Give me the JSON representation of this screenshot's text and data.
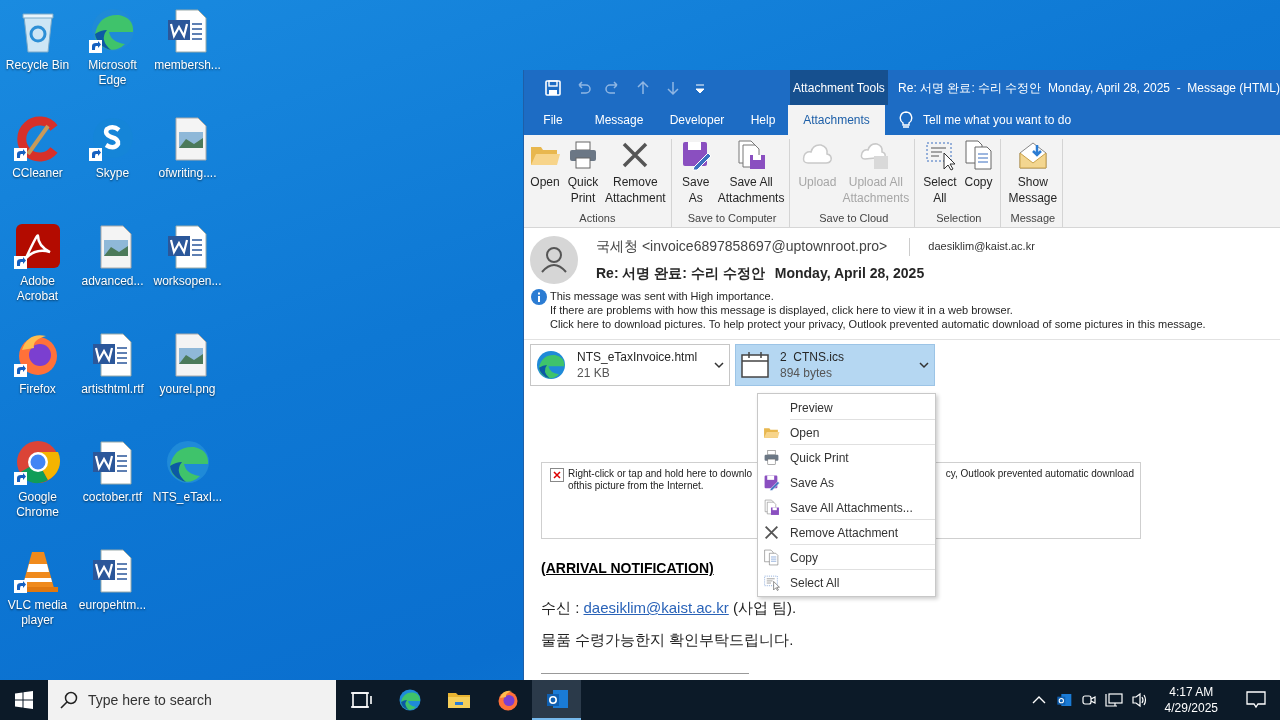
{
  "desktop": {
    "icons": [
      {
        "label": "Recycle Bin",
        "kind": "recycle",
        "shortcut": false
      },
      {
        "label": "CCleaner",
        "kind": "ccleaner",
        "shortcut": true
      },
      {
        "label": "Adobe Acrobat",
        "kind": "acrobat",
        "shortcut": true
      },
      {
        "label": "Firefox",
        "kind": "firefox",
        "shortcut": true
      },
      {
        "label": "Google Chrome",
        "kind": "chrome",
        "shortcut": true
      },
      {
        "label": "VLC media player",
        "kind": "vlc",
        "shortcut": true
      },
      {
        "label": "Microsoft Edge",
        "kind": "edge",
        "shortcut": true
      },
      {
        "label": "Skype",
        "kind": "skype",
        "shortcut": true
      },
      {
        "label": "advanced...",
        "kind": "image",
        "shortcut": false
      },
      {
        "label": "artisthtml.rtf",
        "kind": "word",
        "shortcut": false
      },
      {
        "label": "coctober.rtf",
        "kind": "word",
        "shortcut": false
      },
      {
        "label": "europehtm...",
        "kind": "word",
        "shortcut": false
      },
      {
        "label": "membersh...",
        "kind": "word",
        "shortcut": false
      },
      {
        "label": "ofwriting....",
        "kind": "image",
        "shortcut": false
      },
      {
        "label": "worksopen...",
        "kind": "word",
        "shortcut": false
      },
      {
        "label": "yourel.png",
        "kind": "image",
        "shortcut": false
      },
      {
        "label": "NTS_eTaxI...",
        "kind": "edge",
        "shortcut": false
      }
    ]
  },
  "window": {
    "context_tab": "Attachment Tools",
    "title": "Re: 서명 완료: 수리 수정안  Monday, April 28, 2025  -  Message (HTML)",
    "tabs": [
      {
        "label": "File",
        "selected": false
      },
      {
        "label": "Message",
        "selected": false
      },
      {
        "label": "Developer",
        "selected": false
      },
      {
        "label": "Help",
        "selected": false
      },
      {
        "label": "Attachments",
        "selected": true
      }
    ],
    "tell_me": "Tell me what you want to do",
    "ribbon_groups": [
      {
        "label": "Actions",
        "buttons": [
          {
            "label": "Open",
            "kind": "open",
            "disabled": false
          },
          {
            "label": "Quick\nPrint",
            "kind": "print",
            "disabled": false
          },
          {
            "label": "Remove\nAttachment",
            "kind": "remove",
            "disabled": false
          }
        ]
      },
      {
        "label": "Save to Computer",
        "buttons": [
          {
            "label": "Save\nAs",
            "kind": "saveas",
            "disabled": false
          },
          {
            "label": "Save All\nAttachments",
            "kind": "saveall",
            "disabled": false
          }
        ]
      },
      {
        "label": "Save to Cloud",
        "buttons": [
          {
            "label": "Upload",
            "kind": "upload",
            "disabled": true
          },
          {
            "label": "Upload All\nAttachments",
            "kind": "uploadall",
            "disabled": true
          }
        ]
      },
      {
        "label": "Selection",
        "buttons": [
          {
            "label": "Select\nAll",
            "kind": "selectall",
            "disabled": false
          },
          {
            "label": "Copy",
            "kind": "copy",
            "disabled": false
          }
        ]
      },
      {
        "label": "Message",
        "buttons": [
          {
            "label": "Show\nMessage",
            "kind": "showmessage",
            "disabled": false
          }
        ]
      }
    ],
    "message": {
      "sender": "국세청 <invoice6897858697@uptownroot.pro>",
      "to": "daesiklim@kaist.ac.kr",
      "subject": "Re: 서명 완료: 수리 수정안",
      "date": "Monday, April 28, 2025",
      "info": [
        "This message was sent with High importance.",
        "If there are problems with how this message is displayed, click here to view it in a web browser.",
        "Click here to download pictures. To help protect your privacy, Outlook prevented automatic download of some pictures in this message."
      ],
      "attachments": [
        {
          "name": "NTS_eTaxInvoice.html",
          "size": "21 KB",
          "kind": "html",
          "selected": false
        },
        {
          "name": "2  CTNS.ics",
          "size": "894 bytes",
          "kind": "calendar",
          "selected": true
        }
      ],
      "blocked_image": {
        "line_1_left": "Right-click or tap and hold here to downlo",
        "line_1_right": "cy, Outlook prevented automatic download",
        "line_2": "ofthis picture from the Internet."
      },
      "heading": "(ARRIVAL NOTIFICATION)",
      "recipient_label": "수신 : ",
      "recipient_link": "daesiklim@kaist.ac.kr",
      "recipient_team": " (사업 팀).",
      "request": "물품 수령가능한지 확인부탁드립니다."
    },
    "context_menu": [
      {
        "label": "Preview",
        "kind": "plain",
        "divider": true
      },
      {
        "label": "Open",
        "kind": "open",
        "divider": true
      },
      {
        "label": "Quick Print",
        "kind": "print",
        "divider": false
      },
      {
        "label": "Save As",
        "kind": "saveas",
        "divider": false
      },
      {
        "label": "Save All Attachments...",
        "kind": "saveall",
        "divider": true
      },
      {
        "label": "Remove Attachment",
        "kind": "remove",
        "divider": true
      },
      {
        "label": "Copy",
        "kind": "copy",
        "divider": true
      },
      {
        "label": "Select All",
        "kind": "selectall",
        "divider": false
      }
    ]
  },
  "taskbar": {
    "search_placeholder": "Type here to search",
    "apps": [
      {
        "kind": "taskview",
        "active": false
      },
      {
        "kind": "edge",
        "active": false
      },
      {
        "kind": "explorer",
        "active": false
      },
      {
        "kind": "firefox",
        "active": false
      },
      {
        "kind": "outlook",
        "active": true
      }
    ],
    "time": "4:17 AM",
    "date": "4/29/2025"
  }
}
